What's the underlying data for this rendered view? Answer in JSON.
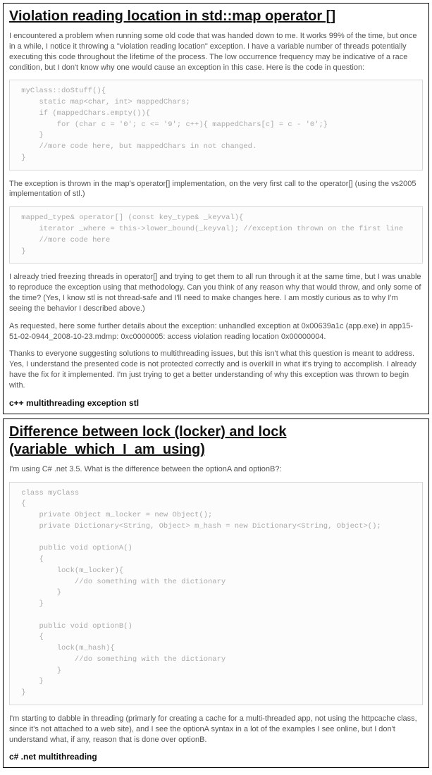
{
  "posts": [
    {
      "title": "Violation reading location in std::map operator []",
      "para1": "I encountered a problem when running some old code that was handed down to me. It works 99% of the time, but once in a while, I notice it throwing a \"violation reading location\" exception. I have a variable number of threads potentially executing this code throughout the lifetime of the process. The low occurrence frequency may be indicative of a race condition, but I don't know why one would cause an exception in this case. Here is the code in question:",
      "code1": " myClass::doStuff(){\n     static map<char, int> mappedChars;\n     if (mappedChars.empty()){\n         for (char c = '0'; c <= '9'; c++){ mappedChars[c] = c - '0';}\n     }\n     //more code here, but mappedChars in not changed.\n }",
      "para2": "The exception is thrown in the map's operator[] implementation, on the very first call to the operator[] (using the vs2005 implementation of stl.)",
      "code2": " mapped_type& operator[] (const key_type& _keyval){\n     iterator _where = this->lower_bound(_keyval); //exception thrown on the first line\n     //more code here\n }",
      "para3": "I already tried freezing threads in operator[] and trying to get them to all run through it at the same time, but I was unable to reproduce the exception using that methodology. Can you think of any reason why that would throw, and only some of the time? (Yes, I know stl is not thread-safe and I'll need to make changes here. I am mostly curious as to why I'm seeing the behavior I described above.)",
      "para4": "As requested, here some further details about the exception: unhandled exception at 0x00639a1c (app.exe) in app15-51-02-0944_2008-10-23.mdmp: 0xc0000005: access violation reading location 0x00000004.",
      "para5": "Thanks to everyone suggesting solutions to multithreading issues, but this isn't what this question is meant to address. Yes, I understand the presented code is not protected correctly and is overkill in what it's trying to accomplish. I already have the fix for it implemented. I'm just trying to get a better understanding of why this exception was thrown to begin with.",
      "tags": "c++ multithreading exception stl"
    },
    {
      "title": "Difference between lock (locker) and lock (variable_which_I_am_using)",
      "para1": "I'm using C# .net 3.5. What is the difference between the optionA and optionB?:",
      "code1": " class myClass\n {\n     private Object m_locker = new Object();\n     private Dictionary<String, Object> m_hash = new Dictionary<String, Object>();\n\n     public void optionA()\n     {\n         lock(m_locker){\n             //do something with the dictionary\n         }\n     }\n\n     public void optionB()\n     {\n         lock(m_hash){\n             //do something with the dictionary\n         }\n     }\n }",
      "para2": "I'm starting to dabble in threading (primarly for creating a cache for a multi-threaded app, not using the httpcache class, since it's not attached to a web site), and I see the optionA syntax in a lot of the examples I see online, but I don't understand what, if any, reason that is done over optionB.",
      "tags": "c# .net multithreading"
    }
  ]
}
